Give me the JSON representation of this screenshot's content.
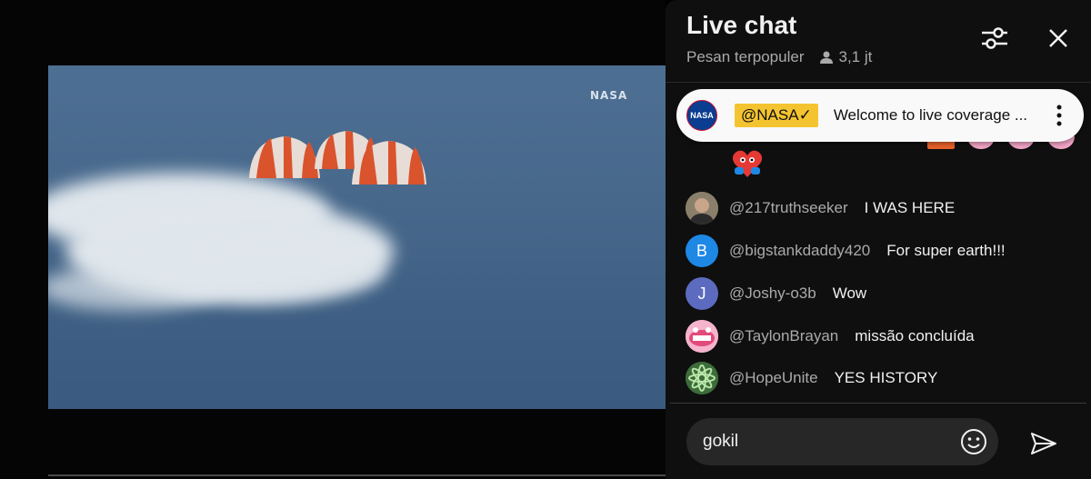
{
  "video": {
    "watermark": "NASA"
  },
  "chat": {
    "title": "Live chat",
    "mode": "Pesan terpopuler",
    "viewer_count": "3,1 jt",
    "pinned": {
      "author": "@NASA",
      "verified_mark": "✓",
      "avatar_text": "NASA",
      "text": "Welcome to live coverage ..."
    },
    "messages": [
      {
        "author": "@217truthseeker",
        "text": "I WAS HERE",
        "avatar": "",
        "avatar_color": "#6b6250"
      },
      {
        "author": "@bigstankdaddy420",
        "text": "For super earth!!!",
        "avatar": "B",
        "avatar_color": "#1e88e5"
      },
      {
        "author": "@Joshy-o3b",
        "text": "Wow",
        "avatar": "J",
        "avatar_color": "#5c6bc0"
      },
      {
        "author": "@TaylonBrayan",
        "text": "missão concluída",
        "avatar": "",
        "avatar_color": "#f06292"
      },
      {
        "author": "@HopeUnite",
        "text": "YES HISTORY",
        "avatar": "",
        "avatar_color": "#2e7d32"
      }
    ],
    "input": {
      "value": "gokil"
    },
    "icons": {
      "settings": "sliders-icon",
      "close": "close-icon",
      "viewers": "person-icon",
      "more": "more-vertical-icon",
      "emoji": "smiley-icon",
      "send": "send-icon"
    },
    "colors": {
      "panel_bg": "#0f0f0f",
      "pinned_bg": "#f9f9f9",
      "owner_badge": "#f4c430",
      "input_bg": "#272727"
    }
  }
}
